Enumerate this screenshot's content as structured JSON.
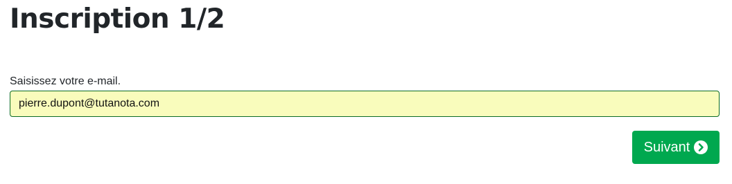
{
  "header": {
    "title": "Inscription 1/2"
  },
  "form": {
    "email_label": "Saisissez votre e-mail.",
    "email_value": "pierre.dupont@tutanota.com"
  },
  "actions": {
    "next_label": "Suivant",
    "next_icon": "chevron-circle-right-icon"
  },
  "colors": {
    "input_background": "#f9fcbc",
    "input_border": "#0b6b24",
    "button_background": "#00a84f",
    "button_text": "#ffffff"
  }
}
